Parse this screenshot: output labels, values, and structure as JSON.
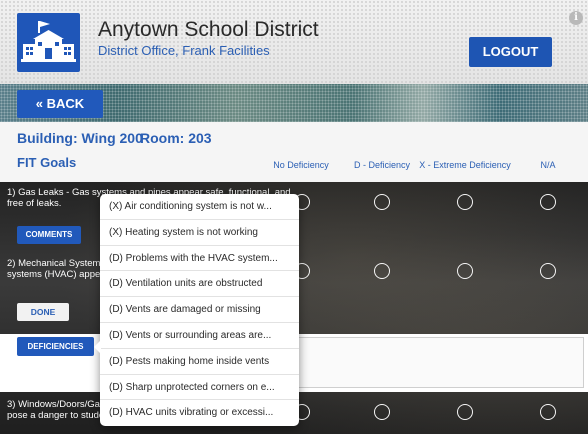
{
  "header": {
    "title": "Anytown School District",
    "subtitle": "District Office, Frank Facilities",
    "logout_label": "LOGOUT",
    "info_symbol": "i"
  },
  "nav": {
    "back_label": "« BACK"
  },
  "location": {
    "building": "Building: Wing 200",
    "room": "Room: 203"
  },
  "section_title": "FIT Goals",
  "columns": [
    "No Deficiency",
    "D - Deficiency",
    "X - Extreme Deficiency",
    "N/A"
  ],
  "items": [
    {
      "text": "1) Gas Leaks - Gas systems and pipes appear safe, functional, and free of leaks."
    },
    {
      "text": "2) Mechanical Systems - Heating, ventilation, and air conditioning systems (HVAC) appear functional and unobstructed."
    },
    {
      "text": "3) Windows/Doors/Gates (interior and exterior) - Conditions that pose a danger to students and staff are not evident."
    }
  ],
  "buttons": {
    "comments": "COMMENTS",
    "done": "DONE",
    "deficiencies": "DEFICIENCIES"
  },
  "popover": {
    "options": [
      "(X) Air conditioning system is not w...",
      "(X) Heating system is not working",
      "(D) Problems with the HVAC system...",
      "(D) Ventilation units are obstructed",
      "(D) Vents are damaged or missing",
      "(D) Vents or surrounding areas are...",
      "(D) Pests making home inside vents",
      "(D) Sharp unprotected corners on e...",
      "(D) HVAC units vibrating or excessi..."
    ]
  },
  "colors": {
    "accent": "#2159bb",
    "link": "#2b5fb4"
  }
}
